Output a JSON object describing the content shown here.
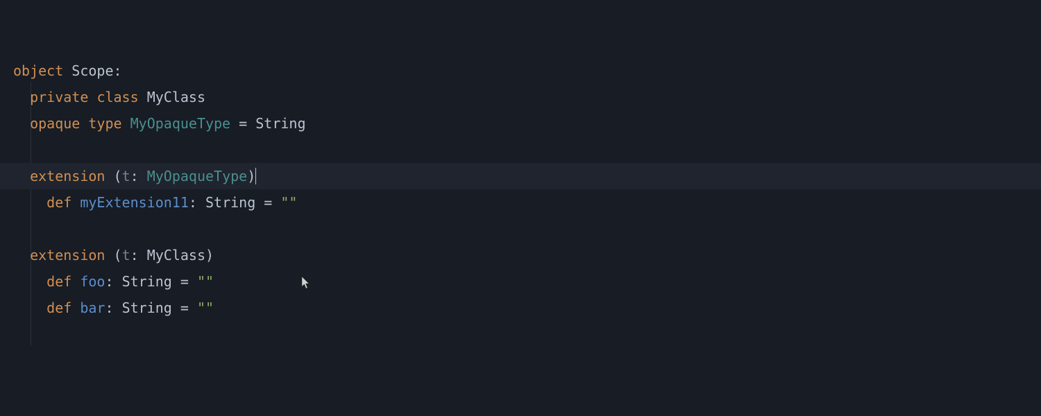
{
  "code": {
    "line1": {
      "kw_object": "object",
      "ident_scope": "Scope",
      "colon": ":"
    },
    "line2": {
      "kw_private": "private",
      "kw_class": "class",
      "ident_myclass": "MyClass"
    },
    "line3": {
      "kw_opaque": "opaque",
      "kw_type": "type",
      "type_myopaque": "MyOpaqueType",
      "eq": " = ",
      "ident_string": "String"
    },
    "line5": {
      "kw_extension": "extension",
      "lparen": " (",
      "param_t": "t",
      "colon": ": ",
      "type_myopaque": "MyOpaqueType",
      "rparen": ")"
    },
    "line6": {
      "kw_def": "def",
      "method": "myExtension11",
      "colon": ": ",
      "ident_string": "String",
      "eq": " = ",
      "str": "\"\""
    },
    "line8": {
      "kw_extension": "extension",
      "lparen": " (",
      "param_t": "t",
      "colon": ": ",
      "ident_myclass": "MyClass",
      "rparen": ")"
    },
    "line9": {
      "kw_def": "def",
      "method": "foo",
      "colon": ": ",
      "ident_string": "String",
      "eq": " = ",
      "str": "\"\""
    },
    "line10": {
      "kw_def": "def",
      "method": "bar",
      "colon": ": ",
      "ident_string": "String",
      "eq": " = ",
      "str": "\"\""
    }
  },
  "colors": {
    "background": "#171c25",
    "highlight": "#1f242e",
    "keyword": "#d18f52",
    "type": "#4a8f8f",
    "identifier": "#bcc4d0",
    "method": "#5c8ec9",
    "string": "#8fae6a",
    "dim": "#7a828e"
  }
}
